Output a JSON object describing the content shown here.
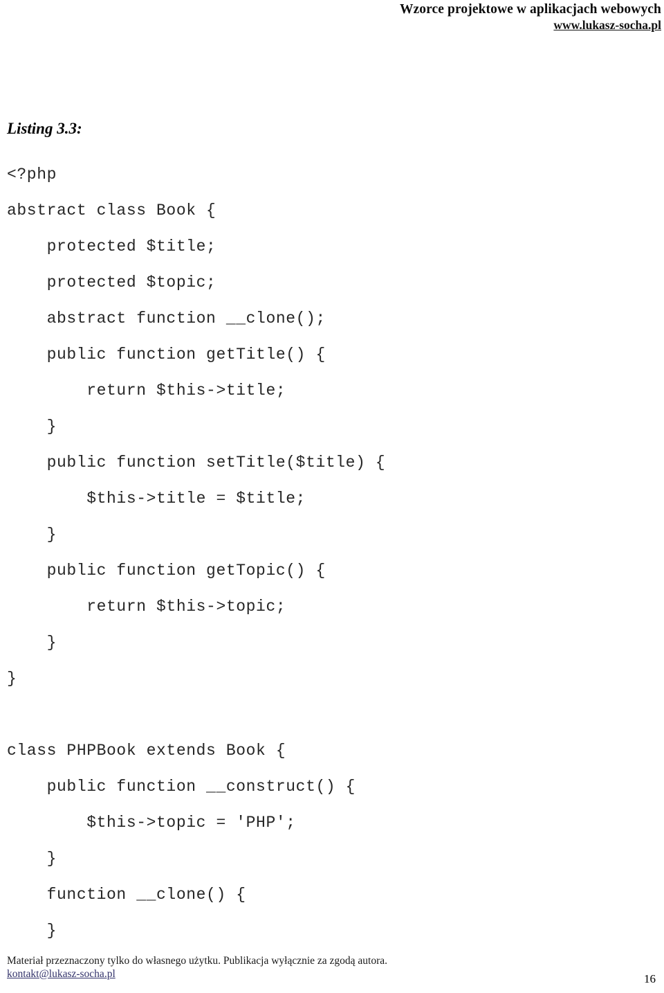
{
  "header": {
    "title": "Wzorce projektowe w aplikacjach webowych",
    "website_link": "www.lukasz-socha.pl"
  },
  "listing": {
    "title": "Listing 3.3:",
    "language": "php",
    "code_lines": [
      "<?php",
      "abstract class Book {",
      "    protected $title;",
      "    protected $topic;",
      "    abstract function __clone();",
      "    public function getTitle() {",
      "        return $this->title;",
      "    }",
      "    public function setTitle($title) {",
      "        $this->title = $title;",
      "    }",
      "    public function getTopic() {",
      "        return $this->topic;",
      "    }",
      "}",
      "",
      "class PHPBook extends Book {",
      "    public function __construct() {",
      "        $this->topic = 'PHP';",
      "    }",
      "    function __clone() {",
      "    }"
    ]
  },
  "footer": {
    "notice": "Materiał przeznaczony tylko do własnego użytku. Publikacja wyłącznie za zgodą autora.",
    "email_link": "kontakt@lukasz-socha.pl",
    "page_number": "16"
  },
  "colors": {
    "text": "#000000",
    "code_text": "#262626",
    "footer_link": "#33336b",
    "background": "#ffffff"
  }
}
